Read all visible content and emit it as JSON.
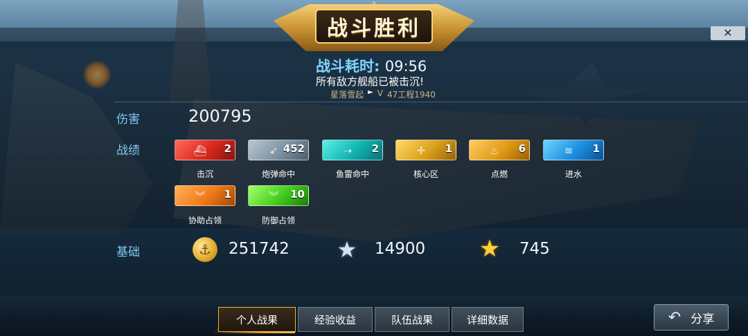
{
  "header": {
    "title": "战斗胜利",
    "duration_label": "战斗耗时:",
    "duration_value": "09:56",
    "result_message": "所有敌方舰船已被击沉!",
    "player_name": "星落雪起",
    "tier": "V",
    "ship_name": "47工程1940",
    "close_icon": "close-icon"
  },
  "stats": {
    "damage_label": "伤害",
    "damage_value": "200795",
    "record_label": "战绩",
    "badges": [
      {
        "label": "击沉",
        "count": "2",
        "icon": "ship-sinking-icon",
        "color": "#d7281e"
      },
      {
        "label": "炮弹命中",
        "count": "452",
        "icon": "shell-icon",
        "color": "#7d93a5"
      },
      {
        "label": "鱼雷命中",
        "count": "2",
        "icon": "torpedo-icon",
        "color": "#12b3b0"
      },
      {
        "label": "核心区",
        "count": "1",
        "icon": "citadel-icon",
        "color": "#dca01d"
      },
      {
        "label": "点燃",
        "count": "6",
        "icon": "fire-icon",
        "color": "#e09a17"
      },
      {
        "label": "进水",
        "count": "1",
        "icon": "flooding-icon",
        "color": "#1b8ee0"
      },
      {
        "label": "协助占领",
        "count": "1",
        "icon": "capture-assist-icon",
        "color": "#f07a18"
      },
      {
        "label": "防御占领",
        "count": "10",
        "icon": "capture-defend-icon",
        "color": "#42cd1e"
      }
    ],
    "base_label": "基础",
    "base": {
      "coins": "251742",
      "silver_exp": "14900",
      "gold_exp": "745"
    }
  },
  "tabs": [
    {
      "label": "个人战果",
      "active": true
    },
    {
      "label": "经验收益",
      "active": false
    },
    {
      "label": "队伍战果",
      "active": false
    },
    {
      "label": "详细数据",
      "active": false
    }
  ],
  "share_label": "分享"
}
